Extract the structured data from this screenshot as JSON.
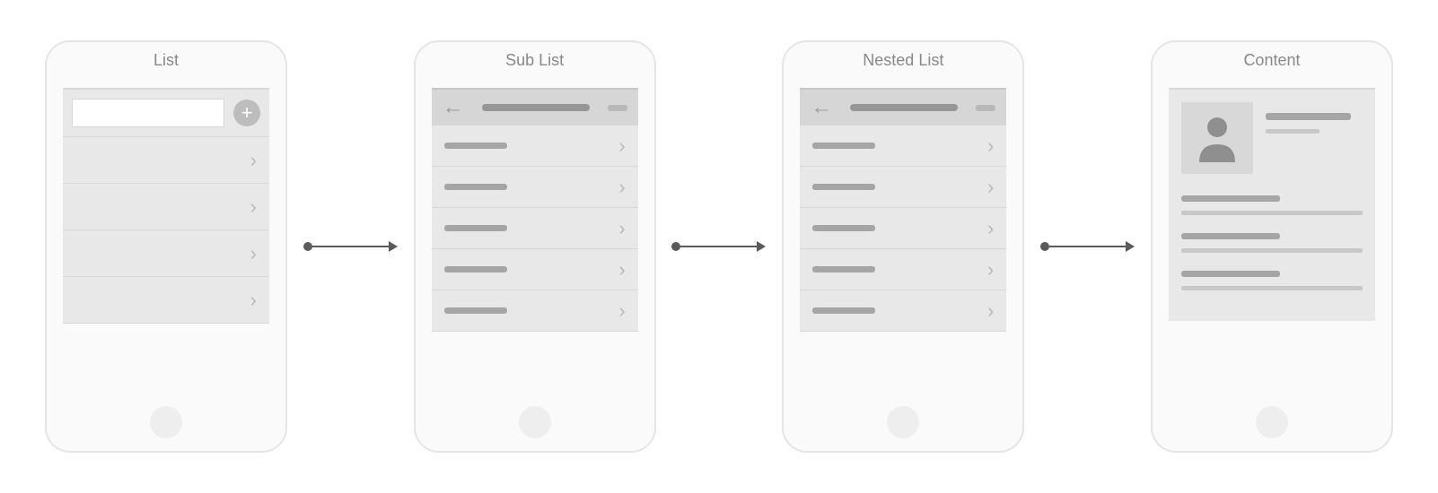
{
  "screens": {
    "list": {
      "title": "List",
      "rows": 4,
      "icons": {
        "add": "plus-icon",
        "chevron": "chevron-right-icon"
      }
    },
    "sublist": {
      "title": "Sub List",
      "rows": 5,
      "icons": {
        "back": "arrow-left-icon",
        "chevron": "chevron-right-icon"
      }
    },
    "nestedlist": {
      "title": "Nested List",
      "rows": 5,
      "icons": {
        "back": "arrow-left-icon",
        "chevron": "chevron-right-icon"
      }
    },
    "content": {
      "title": "Content",
      "icons": {
        "avatar": "user-icon"
      }
    }
  },
  "flow": [
    "list",
    "sublist",
    "nestedlist",
    "content"
  ]
}
